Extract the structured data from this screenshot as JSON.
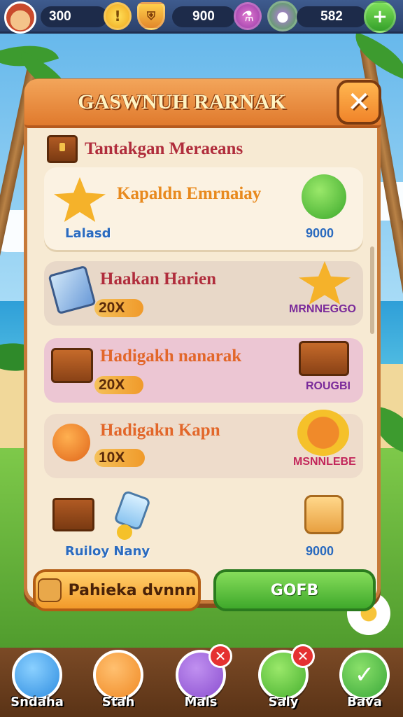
{
  "top_bar": {
    "coins": "300",
    "gold_icon": "!",
    "shield_icon": "shield-icon",
    "gems": "900",
    "potion_icon": "potion-icon",
    "energy": "582",
    "add_icon": "+"
  },
  "dialog": {
    "title": "GASWNUH RARNAK",
    "close_label": "✕",
    "section_title": "Tantakgan Meraeans",
    "cards": [
      {
        "title": "Kapaldn Emrnaiay",
        "sub": "Lalasd",
        "reward": "9000",
        "bg": "#fbf2e2",
        "title_color": "#e88a1e",
        "reward_color": "#2b6bbf"
      },
      {
        "title": "Haakan Harien",
        "pill": "20X",
        "reward": "MRNNEGGO",
        "bg": "#e8d8c8",
        "title_color": "#b02d3c",
        "reward_color": "#7a2a9a"
      },
      {
        "title": "Hadigakh nanarak",
        "pill": "20X",
        "reward": "ROUGBI",
        "bg": "#ecc6d3",
        "title_color": "#e2672a",
        "reward_color": "#7a2a9a"
      },
      {
        "title": "Hadigakn Kapn",
        "pill": "10X",
        "reward": "MSNNLEBE",
        "bg": "#eedccb",
        "title_color": "#e2672a",
        "reward_color": "#c2265a"
      },
      {
        "title": "",
        "sub": "Ruiloy Nany",
        "reward": "9000",
        "bg": "transparent",
        "title_color": "#e2672a",
        "reward_color": "#2b6bbf"
      }
    ],
    "buttons": {
      "left": "Pahieka dvnnn",
      "right": "GOFB"
    }
  },
  "nav": [
    {
      "label": "Sndaha",
      "icon": "magnifier-icon",
      "color": "#2f8de0",
      "badge": ""
    },
    {
      "label": "Stah",
      "icon": "stack-icon",
      "color": "#f08a25",
      "badge": ""
    },
    {
      "label": "Mals",
      "icon": "feather-icon",
      "color": "#8b4fd0",
      "badge": "✕"
    },
    {
      "label": "Saly",
      "icon": "leaf-icon",
      "color": "#47b02f",
      "badge": "✕"
    },
    {
      "label": "Bava",
      "icon": "check-icon",
      "color": "#3aa83a",
      "badge": ""
    }
  ],
  "colors": {
    "accent": "#e07a2d",
    "panel": "#f7ead3",
    "title_red": "#b02d3c"
  }
}
